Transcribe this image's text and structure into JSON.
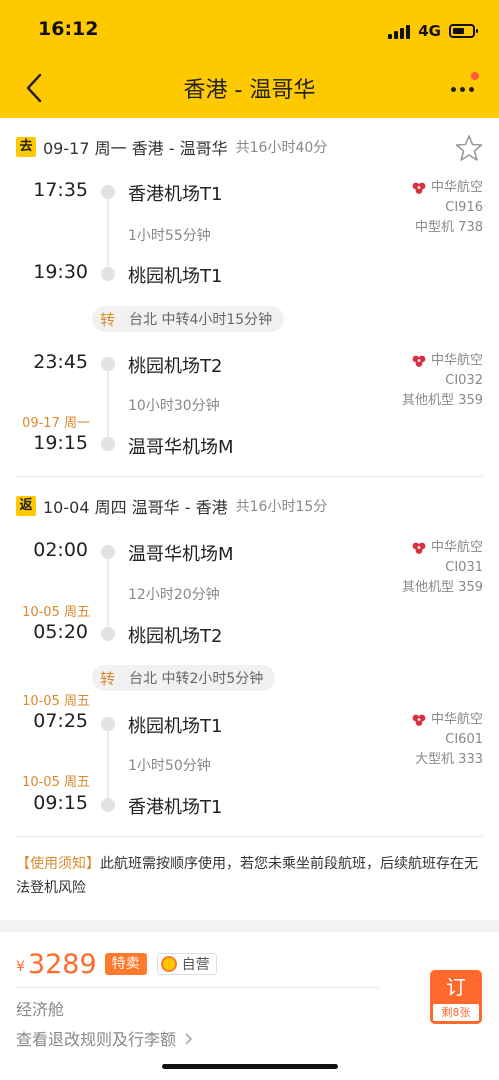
{
  "status_bar": {
    "time": "16:12",
    "network": "4G"
  },
  "header": {
    "title": "香港 - 温哥华"
  },
  "outbound": {
    "tag": "去",
    "summary": "09-17 周一 香港 - 温哥华",
    "total": "共16小时40分",
    "segments": [
      {
        "dep_time": "17:35",
        "dep_airport": "香港机场T1",
        "duration": "1小时55分钟",
        "arr_time": "19:30",
        "arr_airport": "桃园机场T1",
        "airline": "中华航空",
        "flight_no": "CI916",
        "aircraft": "中型机 738"
      },
      {
        "dep_time": "23:45",
        "dep_airport": "桃园机场T2",
        "duration": "10小时30分钟",
        "arr_date": "09-17 周一",
        "arr_time": "19:15",
        "arr_airport": "温哥华机场M",
        "airline": "中华航空",
        "flight_no": "CI032",
        "aircraft": "其他机型 359"
      }
    ],
    "transfer": {
      "label": "转",
      "text": "台北 中转4小时15分钟"
    }
  },
  "return": {
    "tag": "返",
    "summary": "10-04 周四 温哥华 - 香港",
    "total": "共16小时15分",
    "segments": [
      {
        "dep_time": "02:00",
        "dep_airport": "温哥华机场M",
        "duration": "12小时20分钟",
        "arr_date": "10-05 周五",
        "arr_time": "05:20",
        "arr_airport": "桃园机场T2",
        "airline": "中华航空",
        "flight_no": "CI031",
        "aircraft": "其他机型 359"
      },
      {
        "dep_date": "10-05 周五",
        "dep_time": "07:25",
        "dep_airport": "桃园机场T1",
        "duration": "1小时50分钟",
        "arr_date": "10-05 周五",
        "arr_time": "09:15",
        "arr_airport": "香港机场T1",
        "airline": "中华航空",
        "flight_no": "CI601",
        "aircraft": "大型机 333"
      }
    ],
    "transfer": {
      "label": "转",
      "text": "台北 中转2小时5分钟"
    }
  },
  "notice": {
    "tag": "【使用须知】",
    "text": "此航班需按顺序使用，若您未乘坐前段航班，后续航班存在无法登机风险"
  },
  "pricing": {
    "currency": "¥",
    "price": "3289",
    "sale_badge": "特卖",
    "self_badge": "自营",
    "cabin": "经济舱",
    "rules_link": "查看退改规则及行李额",
    "book_label": "订",
    "remaining": "剩8张"
  },
  "colors": {
    "brand_yellow": "#ffc900",
    "accent_orange": "#ff6a2c",
    "date_orange": "#d98a2c",
    "airline_red": "#d9303f"
  },
  "icons": [
    "back-arrow-icon",
    "more-icon",
    "star-icon",
    "airline-logo-icon",
    "chevron-right-icon",
    "signal-icon",
    "battery-icon"
  ]
}
